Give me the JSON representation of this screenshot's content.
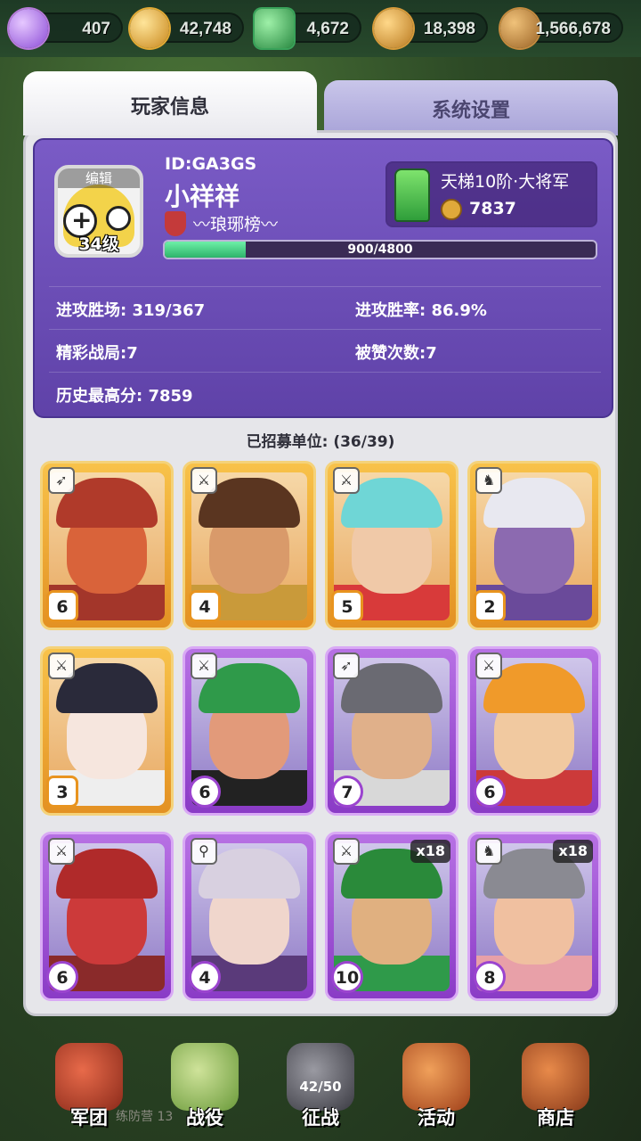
{
  "resources": [
    {
      "icon": "gem-icon",
      "value": "407",
      "color": "#b67ad9"
    },
    {
      "icon": "gold-coin-icon",
      "value": "42,748",
      "color": "#e1a934"
    },
    {
      "icon": "jade-icon",
      "value": "4,672",
      "color": "#39a35a"
    },
    {
      "icon": "grain-icon",
      "value": "18,398",
      "color": "#d59a3a"
    },
    {
      "icon": "wood-icon",
      "value": "1,566,678",
      "color": "#c48a3e"
    }
  ],
  "tabs": {
    "player_info": "玩家信息",
    "system_settings": "系统设置"
  },
  "profile": {
    "avatar_edit": "编辑",
    "level": "34级",
    "id": "ID:GA3GS",
    "name": "小祥祥",
    "guild": "琅琊榜",
    "rank_title": "天梯10阶·大将军",
    "rank_score": "7837",
    "xp_text": "900/4800",
    "xp_fraction": 0.1875
  },
  "stats": {
    "attack_wins": "进攻胜场: 319/367",
    "win_rate": "进攻胜率: 86.9%",
    "great_battles": "精彩战局:7",
    "likes": "被赞次数:7",
    "best_score": "历史最高分: 7859"
  },
  "units_title": "已招募单位: (36/39)",
  "units": [
    {
      "level": "6",
      "rarity": "gold",
      "class_icon": "crossbow-icon",
      "skin": "#d9633a",
      "hair": "#b03a2a",
      "body": "#a3362a"
    },
    {
      "level": "4",
      "rarity": "gold",
      "class_icon": "sword-icon",
      "skin": "#d99a6a",
      "hair": "#5a3520",
      "body": "#c99a3a"
    },
    {
      "level": "5",
      "rarity": "gold",
      "class_icon": "sword-icon",
      "skin": "#f0c9a8",
      "hair": "#6fd6d6",
      "body": "#d83a3a"
    },
    {
      "level": "2",
      "rarity": "gold",
      "class_icon": "horse-icon",
      "skin": "#8c6ab0",
      "hair": "#e8e8f0",
      "body": "#6a4a9a"
    },
    {
      "level": "3",
      "rarity": "gold",
      "class_icon": "sword-icon",
      "skin": "#f6e6de",
      "hair": "#2a2a3a",
      "body": "#eeeeee"
    },
    {
      "level": "6",
      "rarity": "purple",
      "class_icon": "sword-icon",
      "skin": "#e29a7a",
      "hair": "#2f9a4a",
      "body": "#222222"
    },
    {
      "level": "7",
      "rarity": "purple",
      "class_icon": "crossbow-icon",
      "skin": "#e0b08a",
      "hair": "#6a6a72",
      "body": "#d8d8d8"
    },
    {
      "level": "6",
      "rarity": "purple",
      "class_icon": "sword-icon",
      "skin": "#f1c9a0",
      "hair": "#f09a2a",
      "body": "#cc3a3a"
    },
    {
      "level": "6",
      "rarity": "purple",
      "class_icon": "sword-icon",
      "skin": "#cc3a3a",
      "hair": "#b02a2a",
      "body": "#8a2a2a"
    },
    {
      "level": "4",
      "rarity": "purple",
      "class_icon": "staff-icon",
      "skin": "#f0d6cc",
      "hair": "#d8d0e0",
      "body": "#5a3a7a"
    },
    {
      "level": "10",
      "rarity": "purple",
      "class_icon": "sword-icon",
      "skin": "#e0b080",
      "hair": "#2a8a3a",
      "body": "#2f9a4a",
      "mult": "x18"
    },
    {
      "level": "8",
      "rarity": "purple",
      "class_icon": "horse-icon",
      "skin": "#f0c0a0",
      "hair": "#8a8a92",
      "body": "#e8a0a8",
      "mult": "x18"
    }
  ],
  "nav": {
    "legion": "军团",
    "campaign": "战役",
    "battle": "征战",
    "battle_count": "42/50",
    "events": "活动",
    "shop": "商店",
    "subtext": "练防营 13"
  }
}
